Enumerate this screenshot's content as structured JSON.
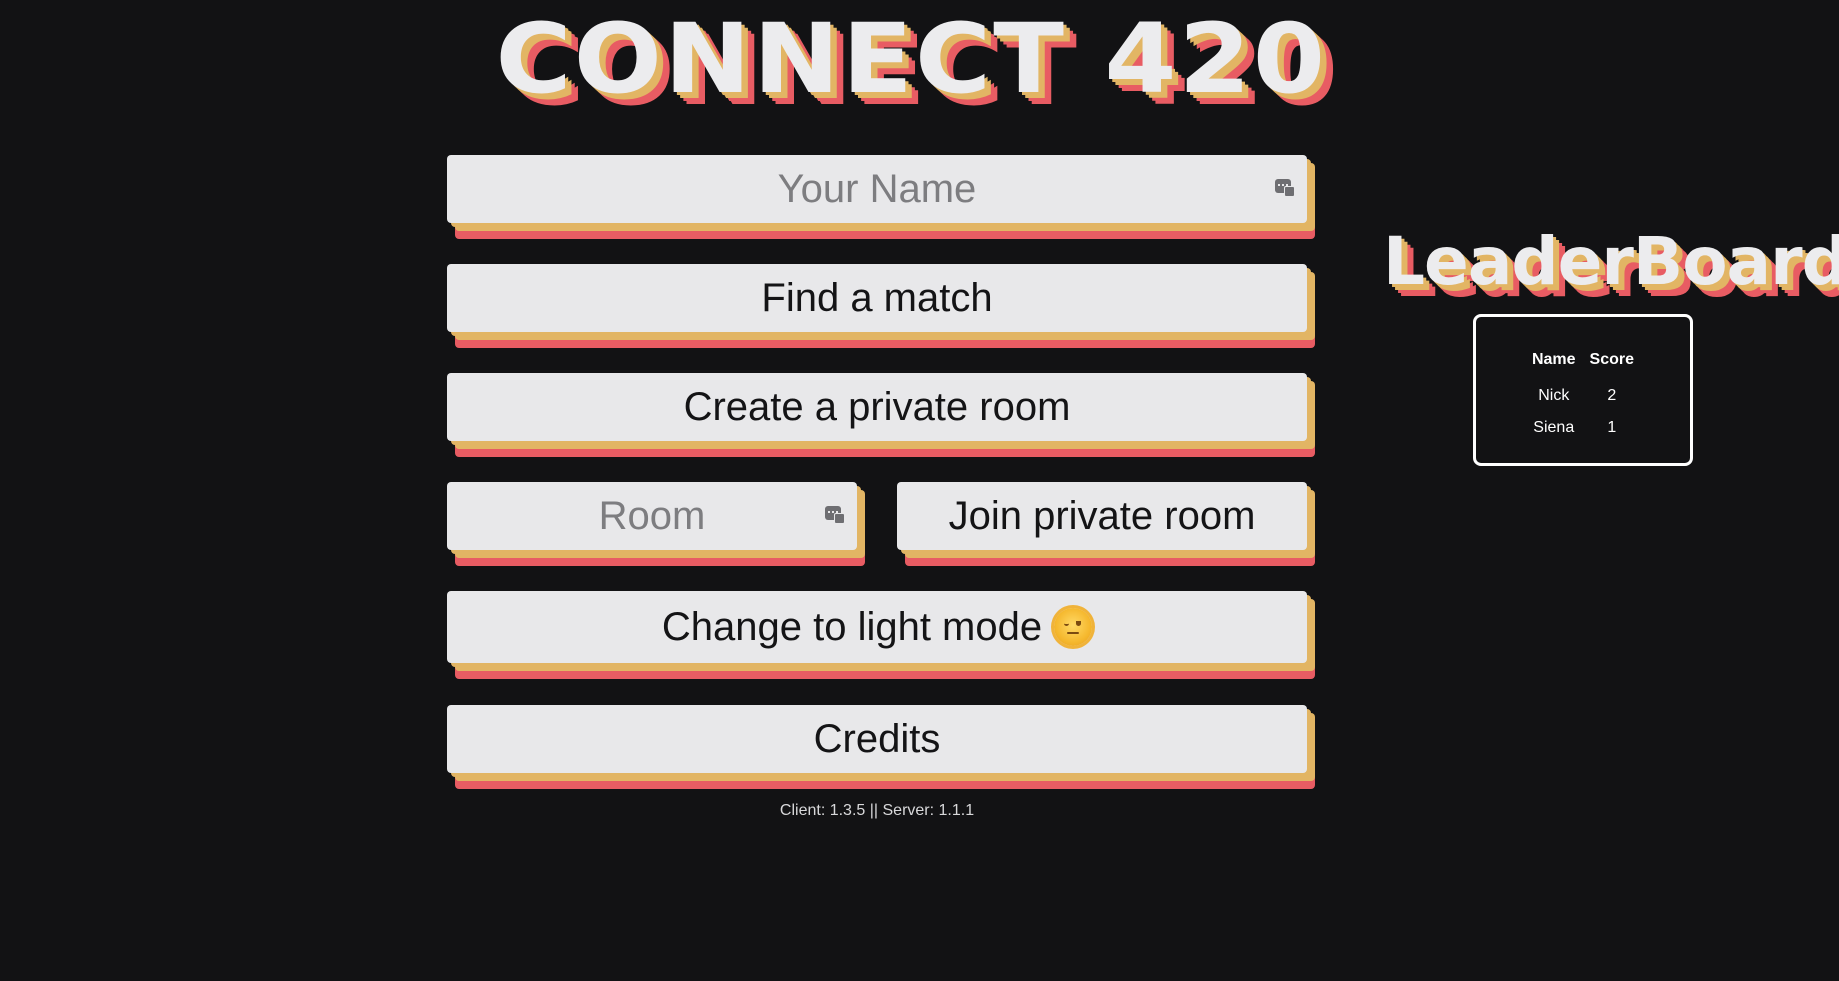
{
  "title": "CONNECT 420",
  "name_input": {
    "placeholder": "Your Name",
    "value": ""
  },
  "find_match_label": "Find a match",
  "create_room_label": "Create a private room",
  "room_input": {
    "placeholder": "Room",
    "value": ""
  },
  "join_room_label": "Join private room",
  "light_mode_label": "Change to light mode",
  "light_mode_icon": "sun-face-emoji",
  "credits_label": "Credits",
  "version_text": "Client: 1.3.5 || Server: 1.1.1",
  "leaderboard": {
    "title": "LeaderBoard",
    "headers": [
      "Name",
      "Score"
    ],
    "rows": [
      {
        "name": "Nick",
        "score": "2"
      },
      {
        "name": "Siena",
        "score": "1"
      }
    ]
  },
  "colors": {
    "background": "#121214",
    "button_face": "#e8e8ea",
    "shadow_gold": "#e2b564",
    "shadow_red": "#e85c63",
    "leaderboard_border": "#ffffff"
  }
}
